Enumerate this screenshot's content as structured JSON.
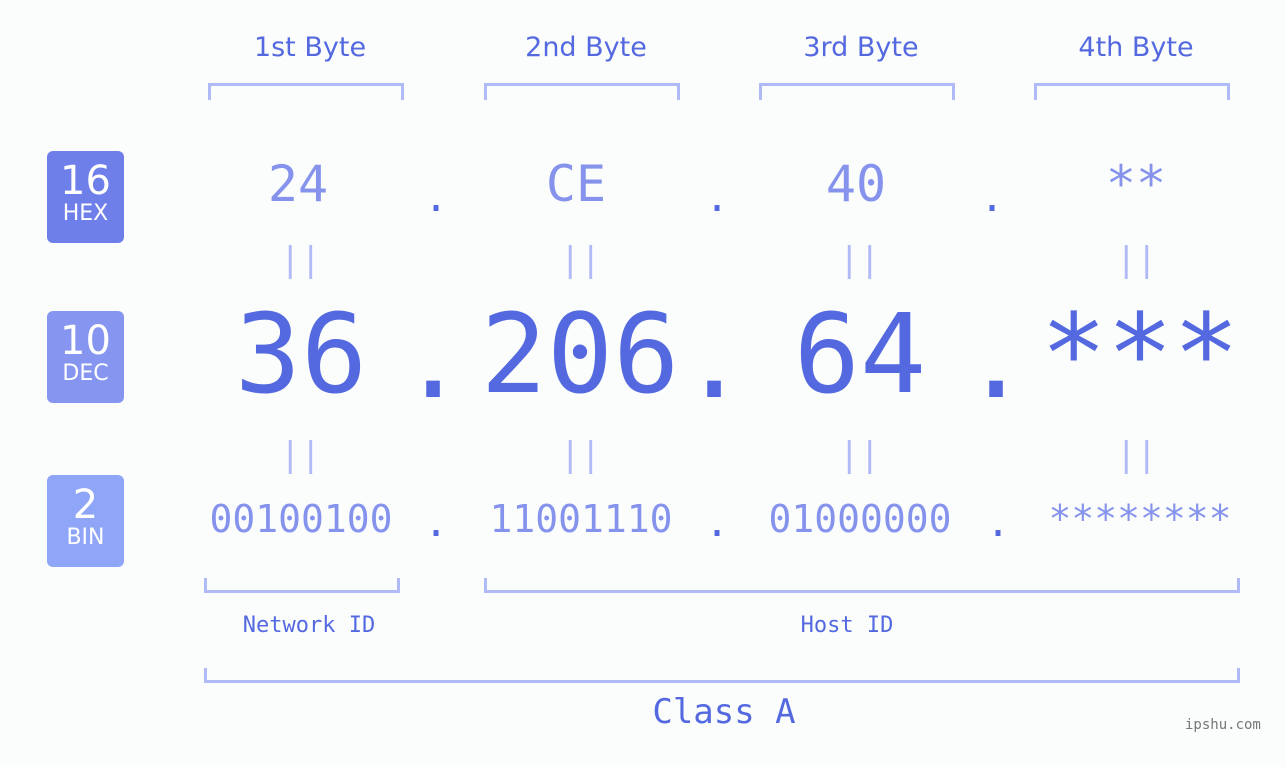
{
  "headers": [
    "1st Byte",
    "2nd Byte",
    "3rd Byte",
    "4th Byte"
  ],
  "badges": [
    {
      "num": "16",
      "label": "HEX",
      "color": "#6f7fe9"
    },
    {
      "num": "10",
      "label": "DEC",
      "color": "#8595f0"
    },
    {
      "num": "2",
      "label": "BIN",
      "color": "#8fa6f8"
    }
  ],
  "hex": [
    "24",
    "CE",
    "40",
    "**"
  ],
  "dec": [
    "36",
    "206",
    "64",
    "***"
  ],
  "bin": [
    "00100100",
    "11001110",
    "01000000",
    "********"
  ],
  "separator": ".",
  "equals": "||",
  "network_id_label": "Network ID",
  "host_id_label": "Host ID",
  "class_label": "Class A",
  "watermark": "ipshu.com"
}
